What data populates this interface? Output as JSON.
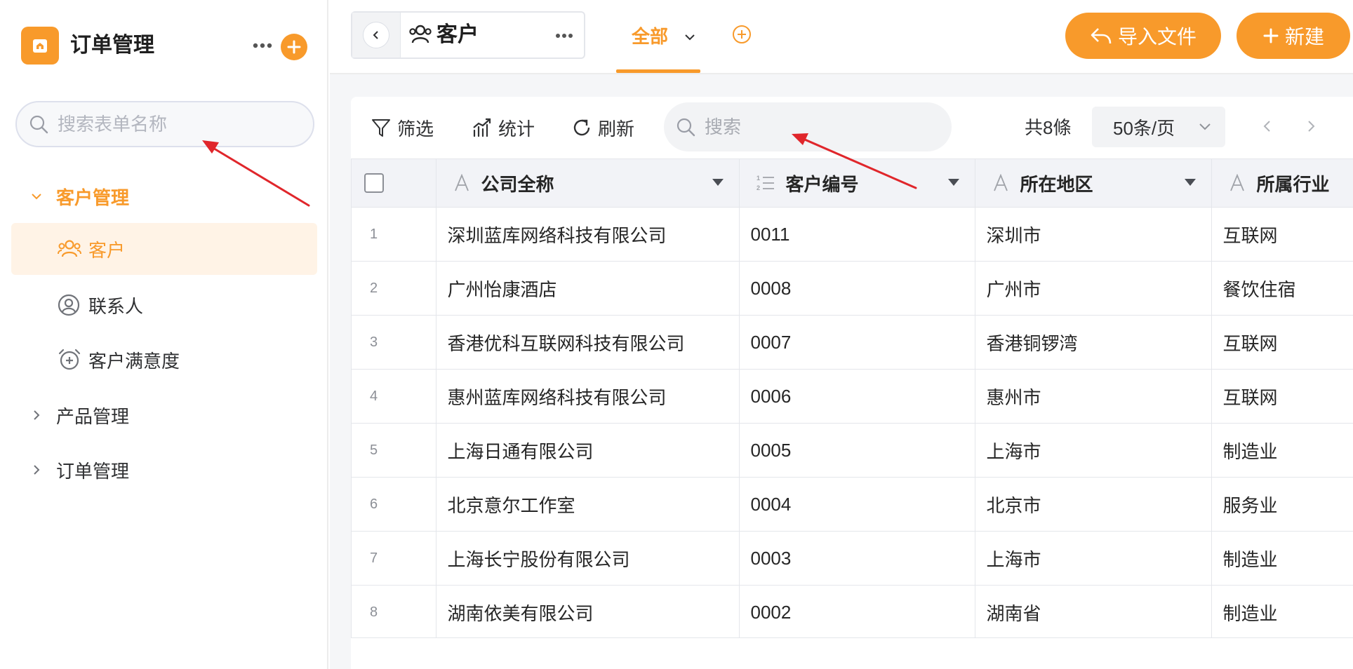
{
  "sidebar": {
    "app_title": "订单管理",
    "search_placeholder": "搜索表单名称",
    "groups": [
      {
        "label": "客户管理",
        "expanded": true,
        "items": [
          {
            "label": "客户",
            "icon": "users-icon",
            "active": true
          },
          {
            "label": "联系人",
            "icon": "user-circle-icon",
            "active": false
          },
          {
            "label": "客户满意度",
            "icon": "alarm-plus-icon",
            "active": false
          }
        ]
      },
      {
        "label": "产品管理",
        "expanded": false
      },
      {
        "label": "订单管理",
        "expanded": false
      }
    ]
  },
  "topbar": {
    "view_title": "客户",
    "tab_label": "全部",
    "import_label": "导入文件",
    "new_label": "新建"
  },
  "toolbar": {
    "filter_label": "筛选",
    "stats_label": "统计",
    "refresh_label": "刷新",
    "search_placeholder": "搜索",
    "total_label": "共8條",
    "page_size_label": "50条/页"
  },
  "table": {
    "columns": [
      {
        "label": "公司全称",
        "type_icon": "text-type-icon"
      },
      {
        "label": "客户编号",
        "type_icon": "numbered-list-icon"
      },
      {
        "label": "所在地区",
        "type_icon": "text-type-icon"
      },
      {
        "label": "所属行业",
        "type_icon": "text-type-icon"
      }
    ],
    "rows": [
      {
        "num": "1",
        "company": "深圳蓝库网络科技有限公司",
        "code": "0011",
        "region": "深圳市",
        "industry": "互联网"
      },
      {
        "num": "2",
        "company": "广州怡康酒店",
        "code": "0008",
        "region": "广州市",
        "industry": "餐饮住宿"
      },
      {
        "num": "3",
        "company": "香港优科互联网科技有限公司",
        "code": "0007",
        "region": "香港铜锣湾",
        "industry": "互联网"
      },
      {
        "num": "4",
        "company": "惠州蓝库网络科技有限公司",
        "code": "0006",
        "region": "惠州市",
        "industry": "互联网"
      },
      {
        "num": "5",
        "company": "上海日通有限公司",
        "code": "0005",
        "region": "上海市",
        "industry": "制造业"
      },
      {
        "num": "6",
        "company": "北京意尔工作室",
        "code": "0004",
        "region": "北京市",
        "industry": "服务业"
      },
      {
        "num": "7",
        "company": "上海长宁股份有限公司",
        "code": "0003",
        "region": "上海市",
        "industry": "制造业"
      },
      {
        "num": "8",
        "company": "湖南依美有限公司",
        "code": "0002",
        "region": "湖南省",
        "industry": "制造业"
      }
    ]
  },
  "colors": {
    "accent": "#f89a2b",
    "active_bg": "#fff3e6",
    "annotation_arrow": "#e0262b"
  }
}
